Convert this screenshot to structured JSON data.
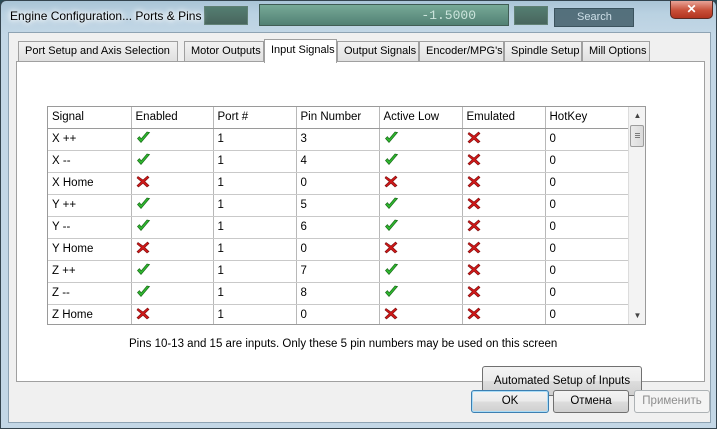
{
  "window": {
    "title": "Engine Configuration... Ports & Pins",
    "close_glyph": "✕"
  },
  "background": {
    "readout": "-1.5000",
    "search": "Search"
  },
  "tabs": [
    {
      "label": "Port Setup and Axis Selection",
      "active": false
    },
    {
      "label": "Motor Outputs",
      "active": false
    },
    {
      "label": "Input Signals",
      "active": true
    },
    {
      "label": "Output Signals",
      "active": false
    },
    {
      "label": "Encoder/MPG's",
      "active": false
    },
    {
      "label": "Spindle Setup",
      "active": false
    },
    {
      "label": "Mill Options",
      "active": false
    }
  ],
  "grid": {
    "columns": [
      "Signal",
      "Enabled",
      "Port #",
      "Pin Number",
      "Active Low",
      "Emulated",
      "HotKey"
    ],
    "rows": [
      {
        "signal": "X ++",
        "enabled": true,
        "port": "1",
        "pin": "3",
        "active_low": true,
        "emulated": false,
        "hotkey": "0"
      },
      {
        "signal": "X --",
        "enabled": true,
        "port": "1",
        "pin": "4",
        "active_low": true,
        "emulated": false,
        "hotkey": "0"
      },
      {
        "signal": "X Home",
        "enabled": false,
        "port": "1",
        "pin": "0",
        "active_low": false,
        "emulated": false,
        "hotkey": "0"
      },
      {
        "signal": "Y ++",
        "enabled": true,
        "port": "1",
        "pin": "5",
        "active_low": true,
        "emulated": false,
        "hotkey": "0"
      },
      {
        "signal": "Y --",
        "enabled": true,
        "port": "1",
        "pin": "6",
        "active_low": true,
        "emulated": false,
        "hotkey": "0"
      },
      {
        "signal": "Y Home",
        "enabled": false,
        "port": "1",
        "pin": "0",
        "active_low": false,
        "emulated": false,
        "hotkey": "0"
      },
      {
        "signal": "Z ++",
        "enabled": true,
        "port": "1",
        "pin": "7",
        "active_low": true,
        "emulated": false,
        "hotkey": "0"
      },
      {
        "signal": "Z --",
        "enabled": true,
        "port": "1",
        "pin": "8",
        "active_low": true,
        "emulated": false,
        "hotkey": "0"
      },
      {
        "signal": "Z Home",
        "enabled": false,
        "port": "1",
        "pin": "0",
        "active_low": false,
        "emulated": false,
        "hotkey": "0"
      }
    ],
    "check_icon": "green-check-icon",
    "cross_icon": "red-x-icon",
    "check_color": "#2fb82f",
    "cross_color": "#d01818",
    "scroll_up_glyph": "▲",
    "scroll_down_glyph": "▼"
  },
  "info_text": "Pins 10-13 and 15 are inputs. Only these 5 pin numbers may be used on this screen",
  "buttons": {
    "automated_setup": "Automated Setup of Inputs",
    "ok": "OK",
    "cancel": "Отмена",
    "apply": "Применить"
  }
}
